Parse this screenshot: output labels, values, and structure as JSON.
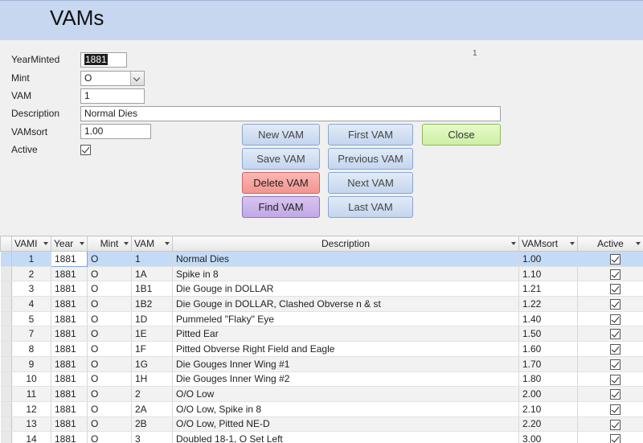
{
  "header": {
    "title": "VAMs"
  },
  "form": {
    "page_number": "1",
    "fields": {
      "year_label": "YearMinted",
      "year_value": "1881",
      "mint_label": "Mint",
      "mint_value": "O",
      "vam_label": "VAM",
      "vam_value": "1",
      "description_label": "Description",
      "description_value": "Normal Dies",
      "vamsort_label": "VAMsort",
      "vamsort_value": "1.00",
      "active_label": "Active",
      "active_checked": true
    },
    "buttons": {
      "new_vam": "New VAM",
      "first_vam": "First VAM",
      "close": "Close",
      "save_vam": "Save VAM",
      "previous_vam": "Previous VAM",
      "delete_vam": "Delete VAM",
      "next_vam": "Next VAM",
      "find_vam": "Find VAM",
      "last_vam": "Last VAM"
    }
  },
  "grid": {
    "columns": [
      "VAMI",
      "Year",
      "Mint",
      "VAM",
      "Description",
      "VAMsort",
      "Active"
    ],
    "rows": [
      {
        "vami": "1",
        "year": "1881",
        "mint": "O",
        "vam": "1",
        "description": "Normal Dies",
        "vamsort": "1.00",
        "active": true
      },
      {
        "vami": "2",
        "year": "1881",
        "mint": "O",
        "vam": "1A",
        "description": "Spike in 8",
        "vamsort": "1.10",
        "active": true
      },
      {
        "vami": "3",
        "year": "1881",
        "mint": "O",
        "vam": "1B1",
        "description": "Die Gouge in DOLLAR",
        "vamsort": "1.21",
        "active": true
      },
      {
        "vami": "4",
        "year": "1881",
        "mint": "O",
        "vam": "1B2",
        "description": "Die Gouge in DOLLAR, Clashed Obverse n & st",
        "vamsort": "1.22",
        "active": true
      },
      {
        "vami": "5",
        "year": "1881",
        "mint": "O",
        "vam": "1D",
        "description": "Pummeled \"Flaky\" Eye",
        "vamsort": "1.40",
        "active": true
      },
      {
        "vami": "7",
        "year": "1881",
        "mint": "O",
        "vam": "1E",
        "description": "Pitted Ear",
        "vamsort": "1.50",
        "active": true
      },
      {
        "vami": "8",
        "year": "1881",
        "mint": "O",
        "vam": "1F",
        "description": "Pitted Obverse Right Field and Eagle",
        "vamsort": "1.60",
        "active": true
      },
      {
        "vami": "9",
        "year": "1881",
        "mint": "O",
        "vam": "1G",
        "description": "Die Gouges Inner Wing #1",
        "vamsort": "1.70",
        "active": true
      },
      {
        "vami": "10",
        "year": "1881",
        "mint": "O",
        "vam": "1H",
        "description": "Die Gouges Inner Wing #2",
        "vamsort": "1.80",
        "active": true
      },
      {
        "vami": "11",
        "year": "1881",
        "mint": "O",
        "vam": "2",
        "description": "O/O Low",
        "vamsort": "2.00",
        "active": true
      },
      {
        "vami": "12",
        "year": "1881",
        "mint": "O",
        "vam": "2A",
        "description": "O/O Low, Spike in 8",
        "vamsort": "2.10",
        "active": true
      },
      {
        "vami": "13",
        "year": "1881",
        "mint": "O",
        "vam": "2B",
        "description": "O/O Low, Pitted NE-D",
        "vamsort": "2.20",
        "active": true
      },
      {
        "vami": "14",
        "year": "1881",
        "mint": "O",
        "vam": "3",
        "description": "Doubled 18-1, O Set Left",
        "vamsort": "3.00",
        "active": true
      }
    ]
  }
}
